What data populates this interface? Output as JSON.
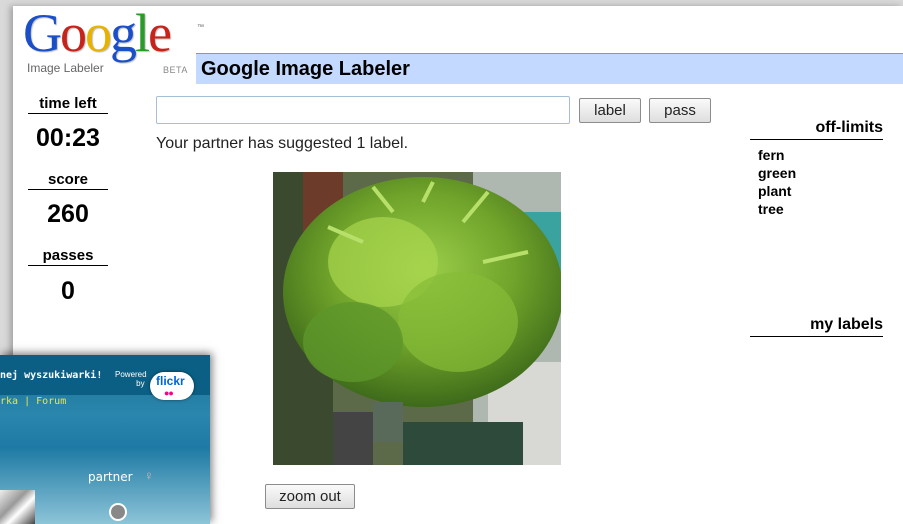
{
  "logo": {
    "word_letters": [
      "G",
      "o",
      "o",
      "g",
      "l",
      "e"
    ],
    "letter_colors": [
      "#1a4fc9",
      "#c8231a",
      "#e8b300",
      "#1a4fc9",
      "#2a9a2a",
      "#c8231a"
    ],
    "trademark": "™",
    "subtitle": "Image Labeler",
    "beta": "BETA"
  },
  "header": {
    "title": "Google Image Labeler"
  },
  "stats": {
    "time_left_label": "time left",
    "time_left_value": "00:23",
    "score_label": "score",
    "score_value": "260",
    "passes_label": "passes",
    "passes_value": "0"
  },
  "guess": {
    "value": "",
    "placeholder": ""
  },
  "buttons": {
    "label": "label",
    "pass": "pass",
    "zoom_out": "zoom out"
  },
  "partner_message": "Your partner has suggested 1 label.",
  "offlimits": {
    "heading": "off-limits",
    "words": [
      "fern",
      "green",
      "plant",
      "tree"
    ]
  },
  "my_labels": {
    "heading": "my labels",
    "items": []
  },
  "overlay": {
    "title": "nej wyszukiwarki!",
    "links": "rka | Forum",
    "powered": "Powered",
    "by": "by",
    "flickr": "flickr",
    "partner": "partner",
    "partner_icon": "female-icon"
  }
}
